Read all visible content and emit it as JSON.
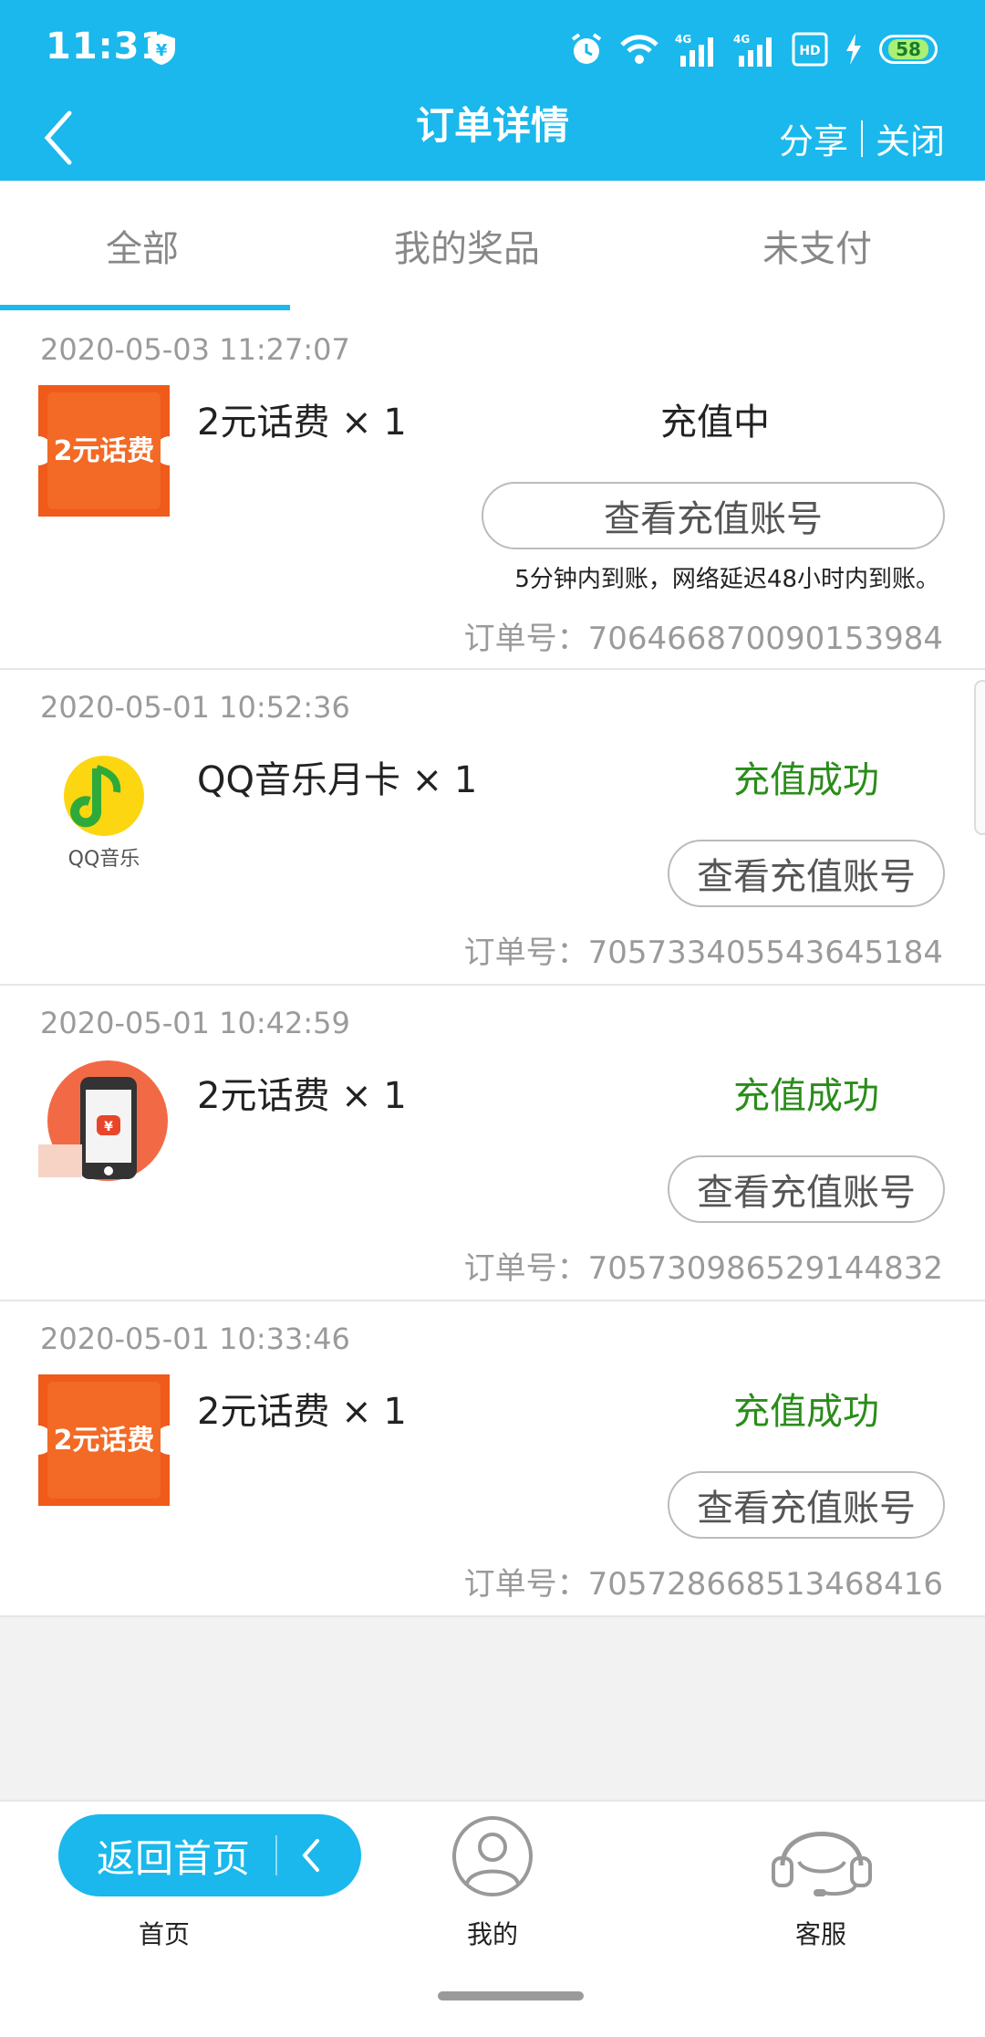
{
  "status_bar": {
    "time": "11:31",
    "battery": "58",
    "network_1": "4G",
    "network_2": "4G",
    "hd": "HD"
  },
  "nav": {
    "title": "订单详情",
    "share": "分享",
    "close": "关闭"
  },
  "tabs": [
    {
      "label": "全部",
      "active": true
    },
    {
      "label": "我的奖品",
      "active": false
    },
    {
      "label": "未支付",
      "active": false
    }
  ],
  "orders": [
    {
      "date": "2020-05-03 11:27:07",
      "thumb_text": "2元话费",
      "name": "2元话费 × 1",
      "status": "充值中",
      "status_color": "#222222",
      "button": "查看充值账号",
      "note": "5分钟内到账，网络延迟48小时内到账。",
      "order_no": "订单号：706466870090153984"
    },
    {
      "date": "2020-05-01 10:52:36",
      "thumb_text": "QQ音乐",
      "name": "QQ音乐月卡 × 1",
      "status": "充值成功",
      "status_color": "#2a8c1a",
      "button": "查看充值账号",
      "order_no": "订单号：705733405543645184"
    },
    {
      "date": "2020-05-01 10:42:59",
      "thumb_text": "¥",
      "name": "2元话费 × 1",
      "status": "充值成功",
      "status_color": "#2a8c1a",
      "button": "查看充值账号",
      "order_no": "订单号：705730986529144832"
    },
    {
      "date": "2020-05-01 10:33:46",
      "thumb_text": "2元话费",
      "name": "2元话费 × 1",
      "status": "充值成功",
      "status_color": "#2a8c1a",
      "button": "查看充值账号",
      "order_no": "订单号：705728668513468416"
    }
  ],
  "bottom_nav": {
    "return_home": "返回首页",
    "home": "首页",
    "mine": "我的",
    "service": "客服"
  },
  "colors": {
    "accent": "#1ab8ec",
    "success": "#2a8c1a",
    "thumb_orange": "#f05a1a"
  }
}
